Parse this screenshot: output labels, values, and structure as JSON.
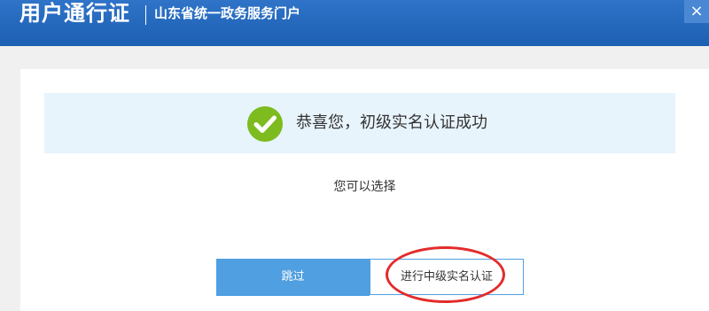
{
  "header": {
    "title": "用户通行证",
    "subtitle": "山东省统一政务服务门户",
    "close_label": "×"
  },
  "main": {
    "success_message": "恭喜您，初级实名认证成功",
    "choose_prompt": "您可以选择",
    "skip_label": "跳过",
    "verify_label": "进行中级实名认证"
  },
  "colors": {
    "header_blue": "#1c5fb3",
    "button_blue": "#4f9fe1",
    "success_green": "#7dbb1e",
    "highlight_red": "#e32b2b",
    "success_bg": "#e8f4fc"
  },
  "icons": {
    "success": "check-circle-icon",
    "close": "close-icon"
  }
}
